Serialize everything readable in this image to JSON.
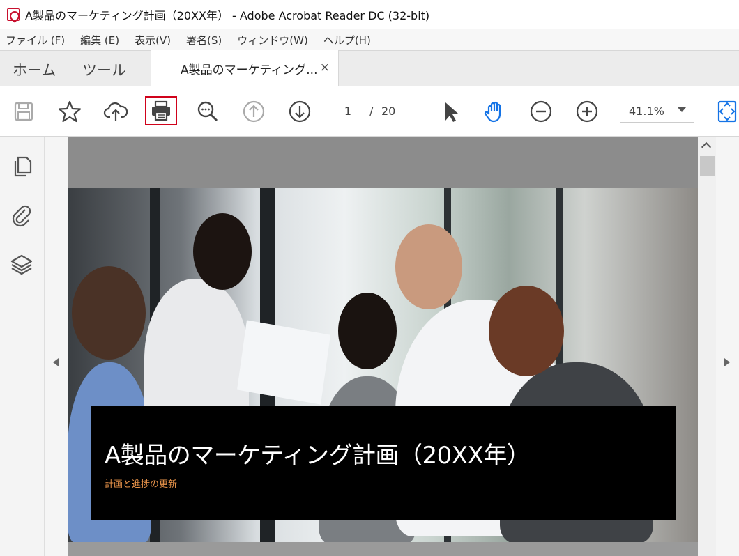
{
  "window": {
    "title": "A製品のマーケティング計画（20XX年） - Adobe Acrobat Reader DC (32-bit)",
    "app_icon": "acrobat-icon"
  },
  "menu": {
    "items": [
      "ファイル (F)",
      "編集 (E)",
      "表示(V)",
      "署名(S)",
      "ウィンドウ(W)",
      "ヘルプ(H)"
    ]
  },
  "tabs": {
    "home": "ホーム",
    "tools": "ツール",
    "document": "A製品のマーケティング...",
    "close": "×"
  },
  "toolbar": {
    "icons": [
      "save-icon",
      "bookmark-star-icon",
      "upload-cloud-icon",
      "print-icon",
      "find-zoom-icon",
      "page-up-icon",
      "page-down-icon",
      "select-cursor-icon",
      "hand-icon",
      "zoom-out-icon",
      "zoom-in-icon",
      "page-fit-icon"
    ],
    "page_current": "1",
    "page_separator": "/",
    "page_total": "20",
    "zoom": "41.1%",
    "highlight_color": "#d0021b",
    "accent_color": "#1473e6"
  },
  "left_panel": {
    "icons": [
      "pages-icon",
      "attachment-icon",
      "layers-icon"
    ]
  },
  "document": {
    "title": "A製品のマーケティング計画（20XX年）",
    "subtitle": "計画と進捗の更新",
    "subtitle_color": "#e8934a"
  }
}
